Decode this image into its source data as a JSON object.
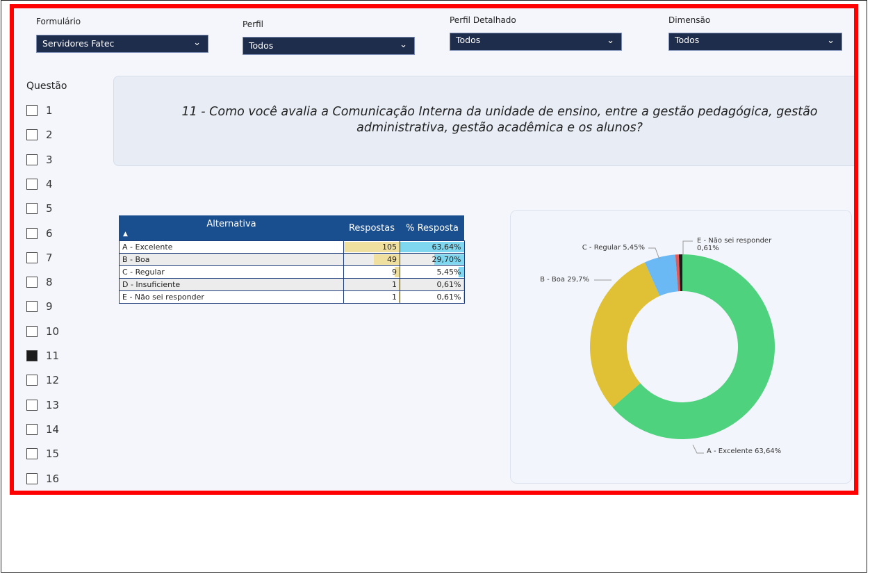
{
  "filters": [
    {
      "label": "Formulário",
      "value": "Servidores Fatec"
    },
    {
      "label": "Perfil",
      "value": "Todos"
    },
    {
      "label": "Perfil Detalhado",
      "value": "Todos"
    },
    {
      "label": "Dimensão",
      "value": "Todos"
    }
  ],
  "question_list": {
    "title": "Questão",
    "items": [
      "1",
      "2",
      "3",
      "4",
      "5",
      "6",
      "7",
      "8",
      "9",
      "10",
      "11",
      "12",
      "13",
      "14",
      "15",
      "16"
    ],
    "selected": "11"
  },
  "question": {
    "text": "11 - Como você avalia a Comunicação Interna da unidade de ensino, entre a gestão pedagógica, gestão administrativa, gestão acadêmica e os alunos?"
  },
  "table": {
    "headers": [
      "Alternativa",
      "Respostas",
      "% Resposta"
    ],
    "rows": [
      {
        "alternativa": "A - Excelente",
        "respostas": "105",
        "percent": "63,64%"
      },
      {
        "alternativa": "B - Boa",
        "respostas": "49",
        "percent": "29,70%"
      },
      {
        "alternativa": "C - Regular",
        "respostas": "9",
        "percent": "5,45%"
      },
      {
        "alternativa": "D - Insuficiente",
        "respostas": "1",
        "percent": "0,61%"
      },
      {
        "alternativa": "E - Não sei responder",
        "respostas": "1",
        "percent": "0,61%"
      }
    ],
    "bar_values": {
      "respostas": [
        105,
        49,
        9,
        1,
        1
      ],
      "percent": [
        63.64,
        29.7,
        5.45,
        0.61,
        0.61
      ]
    },
    "colors": {
      "header": "#1a4f8f",
      "respostas_bar": "#f0e0a0",
      "percent_bar": "#7fd6ef"
    }
  },
  "chart_data": {
    "type": "pie",
    "categories": [
      "A - Excelente",
      "B - Boa",
      "C - Regular",
      "D - Insuficiente",
      "E - Não sei responder"
    ],
    "values": [
      63.64,
      29.7,
      5.45,
      0.61,
      0.61
    ],
    "labels": [
      "A - Excelente 63,64%",
      "B - Boa 29,7%",
      "C - Regular 5,45%",
      "",
      "E - Não sei responder 0,61%"
    ],
    "colors": [
      "#4fd27e",
      "#e0c034",
      "#6ab9f5",
      "#e05b5b",
      "#1b1b1b"
    ]
  }
}
